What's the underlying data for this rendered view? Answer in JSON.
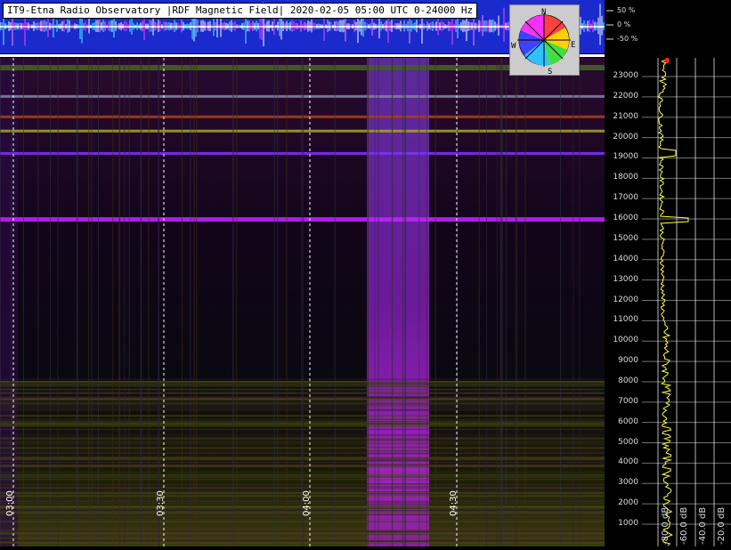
{
  "header": {
    "title": "IT9-Etna Radio Observatory |RDF Magnetic Field| 2020-02-05 05:00 UTC 0-24000 Hz"
  },
  "amplitude_scale": [
    "50 %",
    "0 %",
    "-50 %"
  ],
  "compass": {
    "n": "N",
    "s": "S",
    "e": "E",
    "w": "W"
  },
  "chart_data": {
    "type": "heatmap",
    "title": "IT9-Etna Radio Observatory |RDF Magnetic Field| 2020-02-05 05:00 UTC 0-24000 Hz",
    "x_ticks": [
      "03:00",
      "03:30",
      "04:00",
      "04:30"
    ],
    "y_ticks": [
      1000,
      2000,
      3000,
      4000,
      5000,
      6000,
      7000,
      8000,
      9000,
      10000,
      11000,
      12000,
      13000,
      14000,
      15000,
      16000,
      17000,
      18000,
      19000,
      20000,
      21000,
      22000,
      23000
    ],
    "ylim": [
      0,
      24000
    ],
    "y_unit": "Hz",
    "spectrum_ticks": [
      "-80.0 dB",
      "-60.0 dB",
      "-40.0 dB",
      "-20.0 dB"
    ],
    "strong_lines_hz": [
      16000,
      19200,
      20300,
      21000,
      22000
    ],
    "colors": {
      "background": "#000000",
      "broadband": "#8a2be2",
      "header": "#1a2acc",
      "spectrum": "#ffff40"
    }
  }
}
